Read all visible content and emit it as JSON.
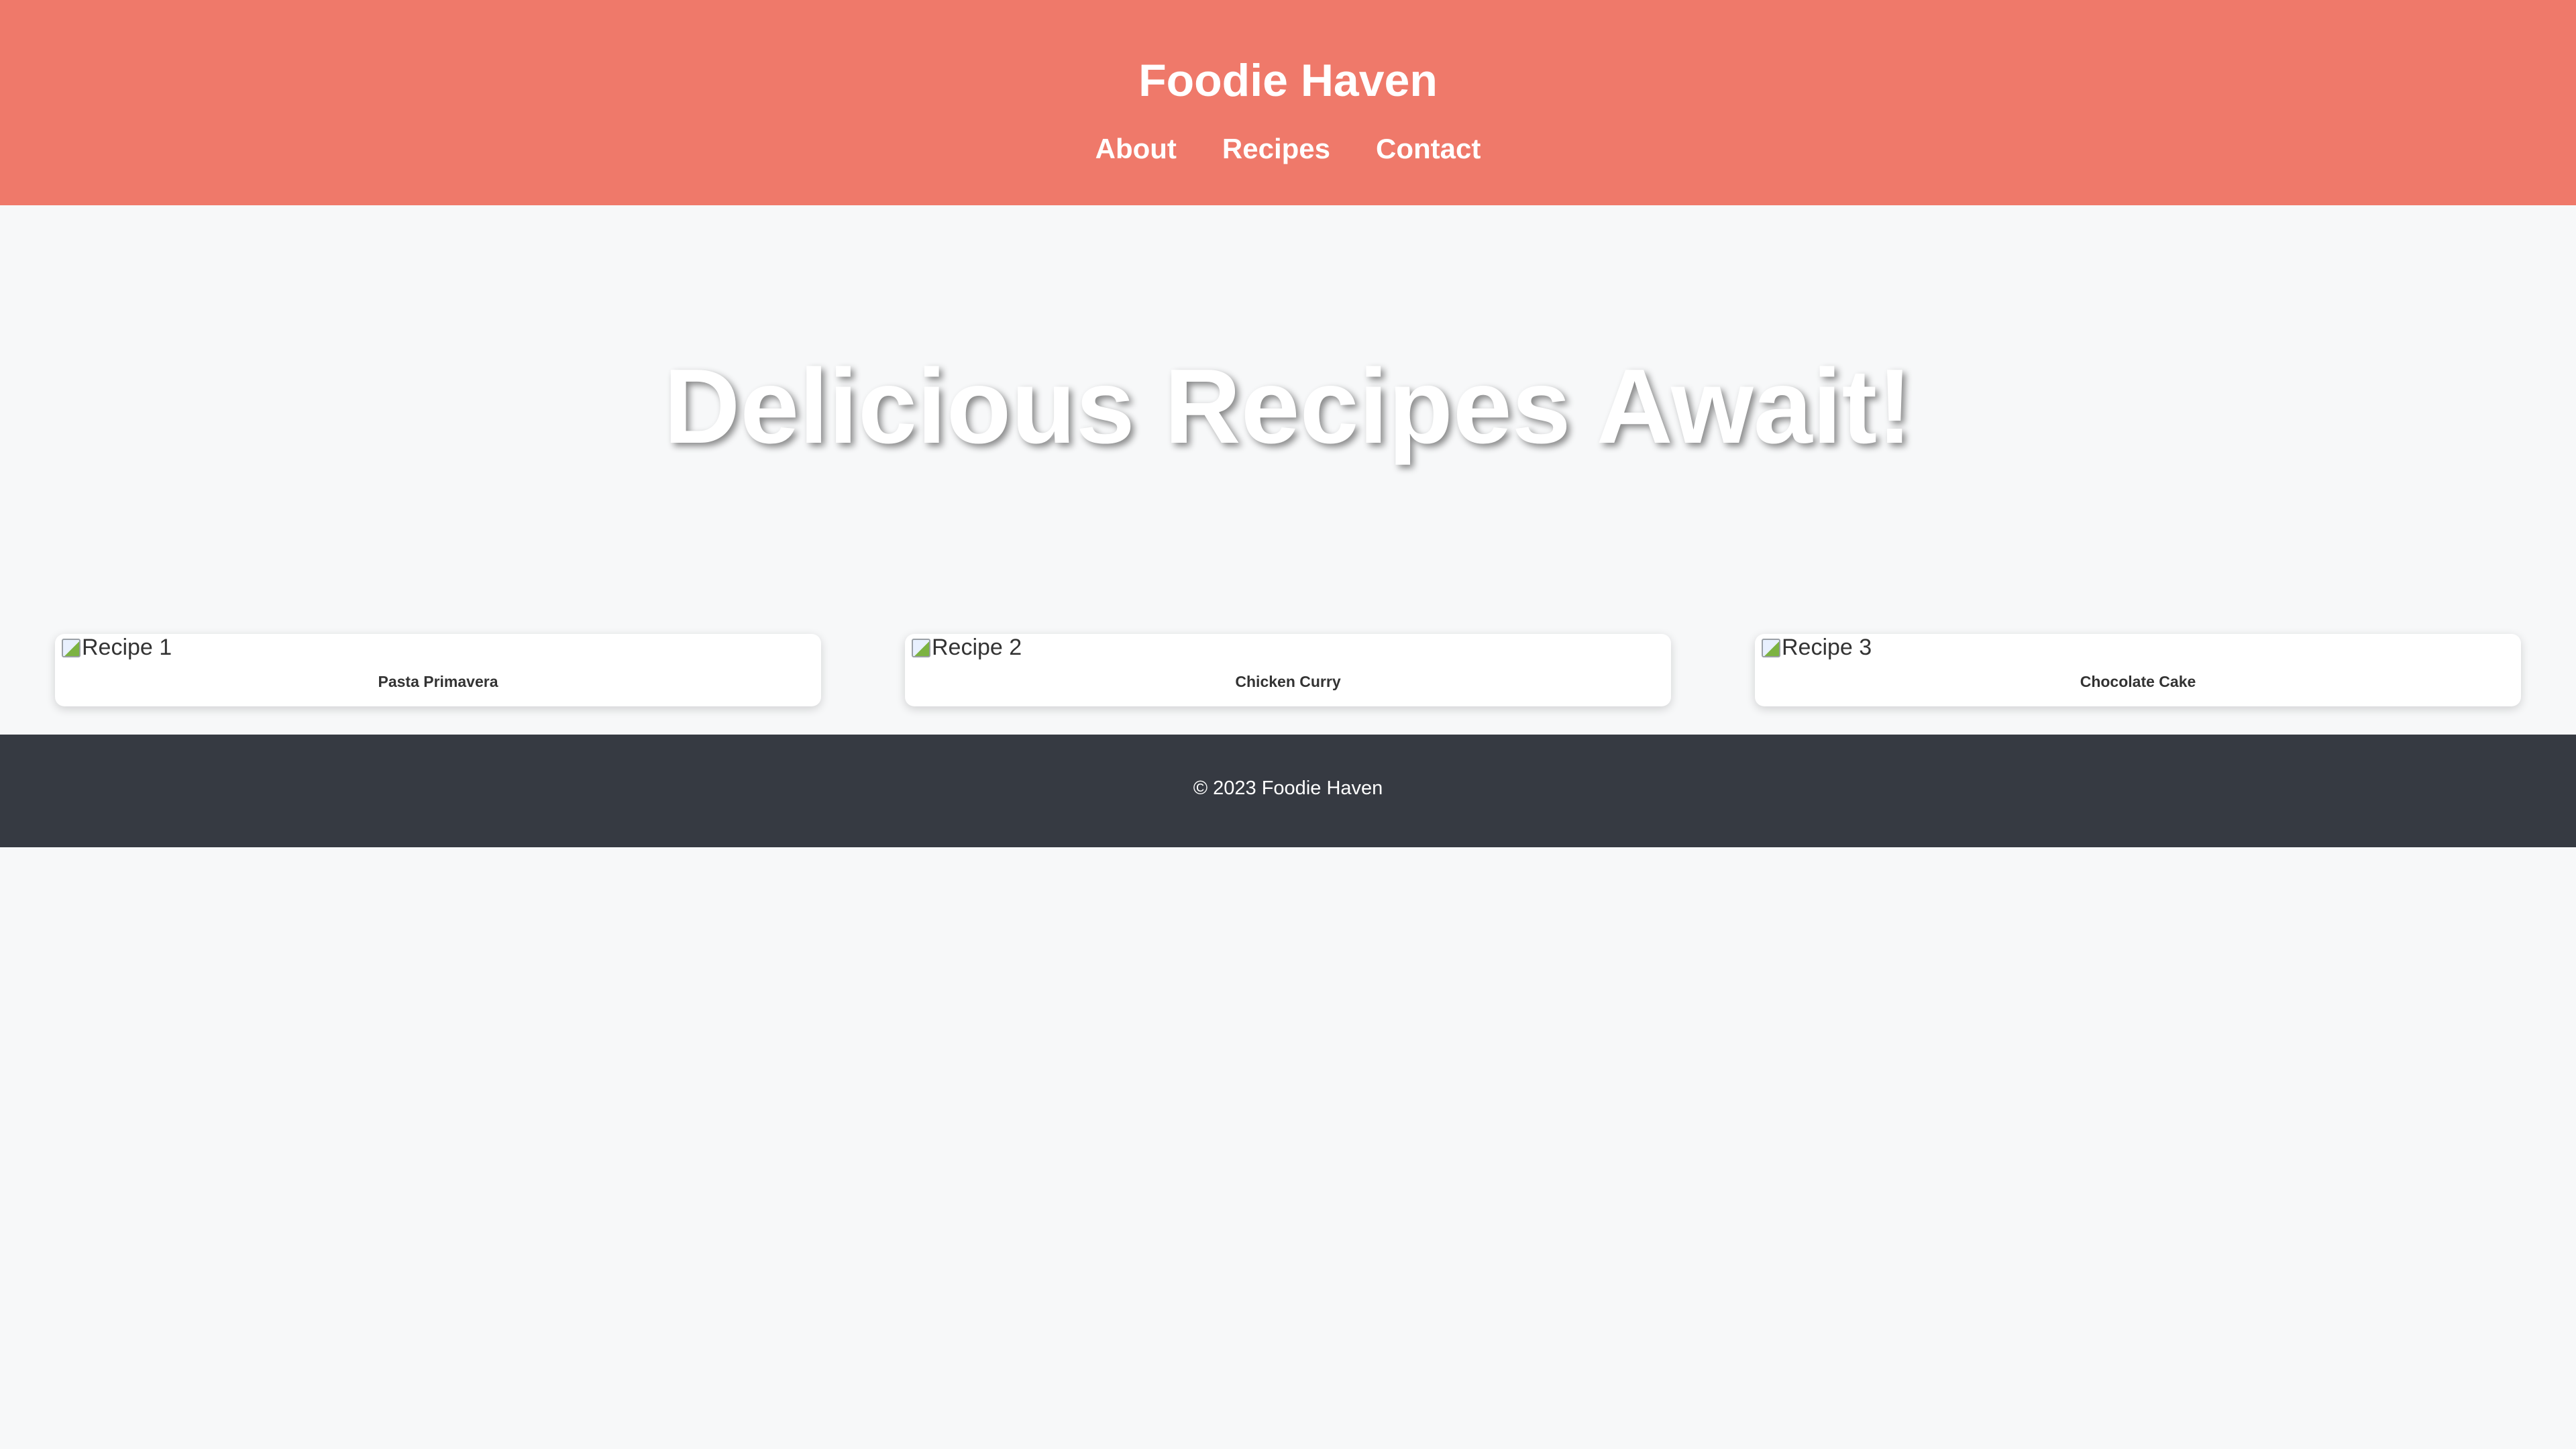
{
  "header": {
    "site_title": "Foodie Haven",
    "nav": [
      {
        "label": "About"
      },
      {
        "label": "Recipes"
      },
      {
        "label": "Contact"
      }
    ],
    "background_color": "#ef796a"
  },
  "hero": {
    "title": "Delicious Recipes Await!"
  },
  "recipes": [
    {
      "image_alt": "Recipe 1",
      "title": "Pasta Primavera"
    },
    {
      "image_alt": "Recipe 2",
      "title": "Chicken Curry"
    },
    {
      "image_alt": "Recipe 3",
      "title": "Chocolate Cake"
    }
  ],
  "footer": {
    "text": "© 2023 Foodie Haven",
    "background_color": "#363a42"
  }
}
